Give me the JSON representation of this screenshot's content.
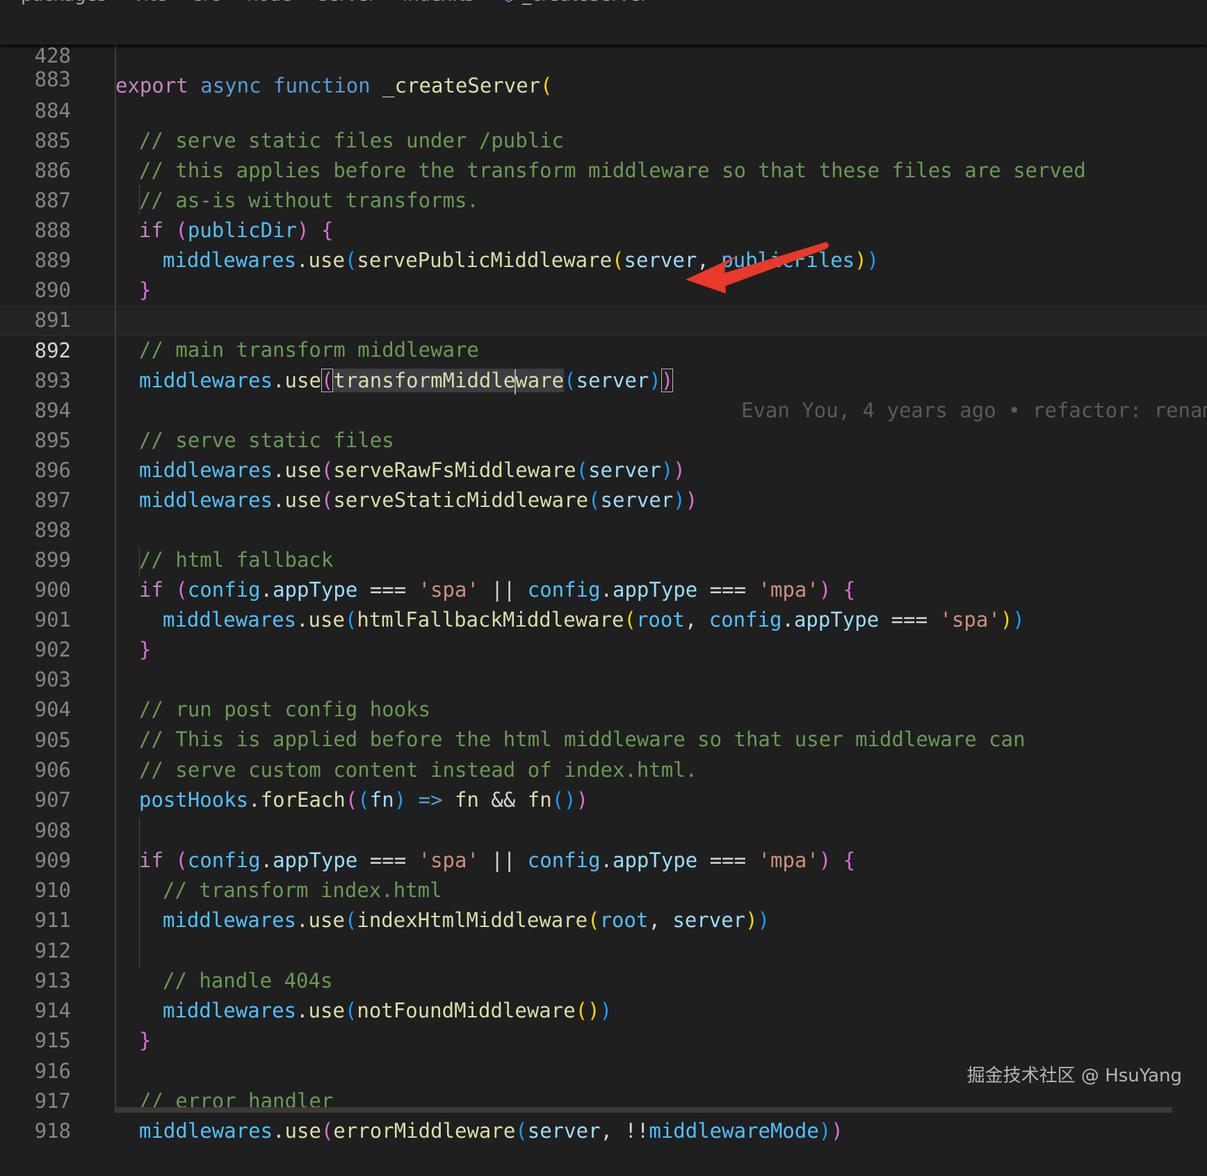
{
  "breadcrumb": {
    "items": [
      "packages",
      "vite",
      "src",
      "node",
      "server",
      "index.ts",
      "_createServer"
    ],
    "separator": ">"
  },
  "sticky_scroll": {
    "line_number": "428",
    "kw_export": "export",
    "kw_async": "async",
    "kw_function": "function",
    "fn_name": "_createServer",
    "paren": "("
  },
  "lines": [
    {
      "n": "883"
    },
    {
      "n": "884",
      "comment": "// serve static files under /public"
    },
    {
      "n": "885",
      "comment": "// this applies before the transform middleware so that these files are served"
    },
    {
      "n": "886",
      "comment": "// as-is without transforms."
    },
    {
      "n": "887",
      "t": [
        "if",
        "(",
        "publicDir",
        ")",
        "{"
      ]
    },
    {
      "n": "888",
      "t": [
        "middlewares",
        ".",
        "use",
        "(",
        "servePublicMiddleware",
        "(",
        "server",
        ", ",
        "publicFiles",
        ")",
        ")"
      ]
    },
    {
      "n": "889",
      "t": [
        "}"
      ]
    },
    {
      "n": "890"
    },
    {
      "n": "891",
      "comment": "// main transform middleware"
    },
    {
      "n": "892",
      "t": [
        "middlewares",
        ".",
        "use",
        "(",
        "transformMiddle",
        "ware",
        "(",
        "server",
        ")",
        ")"
      ],
      "blame": "Evan You, 4 years ago • refactor: renam"
    },
    {
      "n": "893"
    },
    {
      "n": "894",
      "comment": "// serve static files"
    },
    {
      "n": "895",
      "t": [
        "middlewares",
        ".",
        "use",
        "(",
        "serveRawFsMiddleware",
        "(",
        "server",
        ")",
        ")"
      ]
    },
    {
      "n": "896",
      "t": [
        "middlewares",
        ".",
        "use",
        "(",
        "serveStaticMiddleware",
        "(",
        "server",
        ")",
        ")"
      ]
    },
    {
      "n": "897"
    },
    {
      "n": "898",
      "comment": "// html fallback"
    },
    {
      "n": "899",
      "t": [
        "if",
        "(",
        "config",
        ".",
        "appType",
        " === ",
        "'spa'",
        " || ",
        "config",
        ".",
        "appType",
        " === ",
        "'mpa'",
        ")",
        "{"
      ]
    },
    {
      "n": "900",
      "t": [
        "middlewares",
        ".",
        "use",
        "(",
        "htmlFallbackMiddleware",
        "(",
        "root",
        ", ",
        "config",
        ".",
        "appType",
        " === ",
        "'spa'",
        ")",
        ")"
      ]
    },
    {
      "n": "901",
      "t": [
        "}"
      ]
    },
    {
      "n": "902"
    },
    {
      "n": "903",
      "comment": "// run post config hooks"
    },
    {
      "n": "904",
      "comment": "// This is applied before the html middleware so that user middleware can"
    },
    {
      "n": "905",
      "comment": "// serve custom content instead of index.html."
    },
    {
      "n": "906",
      "t": [
        "postHooks",
        ".",
        "forEach",
        "(",
        "(",
        "fn",
        ")",
        " => ",
        "fn",
        " && ",
        "fn",
        "(",
        ")",
        ")"
      ]
    },
    {
      "n": "907"
    },
    {
      "n": "908",
      "t": [
        "if",
        "(",
        "config",
        ".",
        "appType",
        " === ",
        "'spa'",
        " || ",
        "config",
        ".",
        "appType",
        " === ",
        "'mpa'",
        ")",
        "{"
      ]
    },
    {
      "n": "909",
      "comment": "// transform index.html"
    },
    {
      "n": "910",
      "t": [
        "middlewares",
        ".",
        "use",
        "(",
        "indexHtmlMiddleware",
        "(",
        "root",
        ", ",
        "server",
        ")",
        ")"
      ]
    },
    {
      "n": "911"
    },
    {
      "n": "912",
      "comment": "// handle 404s"
    },
    {
      "n": "913",
      "t": [
        "middlewares",
        ".",
        "use",
        "(",
        "notFoundMiddleware",
        "(",
        ")",
        ")"
      ]
    },
    {
      "n": "914",
      "t": [
        "}"
      ]
    },
    {
      "n": "915"
    },
    {
      "n": "916",
      "comment": "// error handler"
    },
    {
      "n": "917",
      "t": [
        "middlewares",
        ".",
        "use",
        "(",
        "errorMiddleware",
        "(",
        "server",
        ", ",
        "!!",
        "middlewareMode",
        ")",
        ")"
      ]
    },
    {
      "n": "918"
    }
  ],
  "watermark": "掘金技术社区 @ HsuYang",
  "colors": {
    "background": "#1f1f1f",
    "comment": "#6a9955",
    "keyword": "#569cd6",
    "control_keyword": "#c586c0",
    "variable": "#4fc1ff",
    "property": "#9cdcfe",
    "function": "#dcdcaa",
    "string": "#ce9178",
    "annotation_arrow": "#e8392a"
  }
}
